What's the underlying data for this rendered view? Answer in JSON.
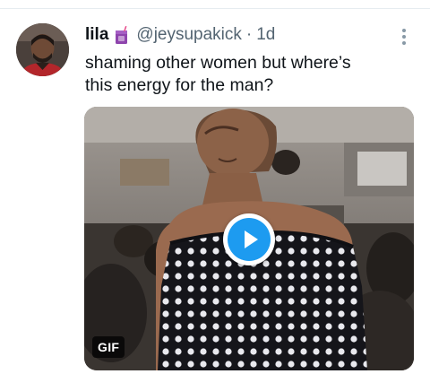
{
  "tweet": {
    "display_name": "lila",
    "name_emoji": "beverage-box-emoji",
    "handle": "@jeysupakick",
    "separator": "·",
    "timestamp": "1d",
    "text_lines": [
      "shaming other women but where’s",
      "this energy for the man?"
    ],
    "more_icon": "vertical-ellipsis-icon"
  },
  "media": {
    "type": "gif",
    "badge": "GIF",
    "play_icon": "play-icon"
  },
  "colors": {
    "text_primary": "#0f1419",
    "text_secondary": "#536471",
    "accent": "#1d9bf0",
    "divider": "#e6ecf0"
  }
}
